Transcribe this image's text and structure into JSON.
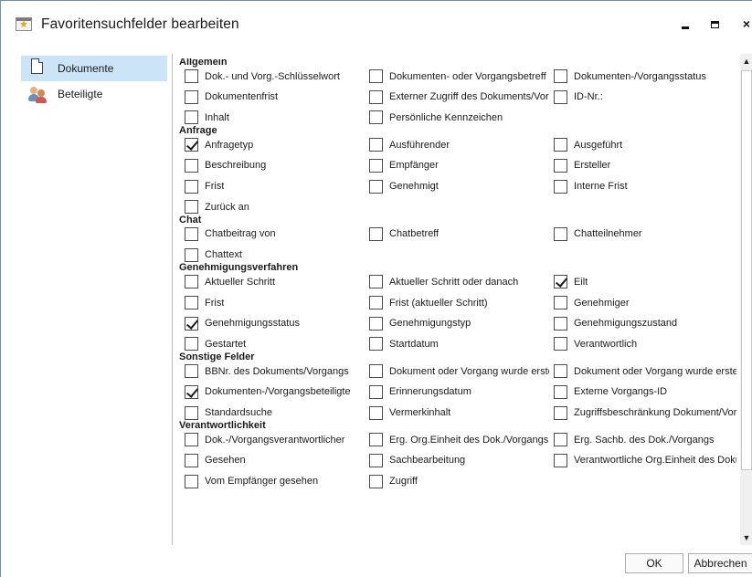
{
  "window": {
    "title": "Favoritensuchfelder bearbeiten",
    "minimize_icon": "minimize-icon",
    "maximize_icon": "maximize-icon",
    "close_label": "×"
  },
  "nav": {
    "items": [
      {
        "label": "Dokumente",
        "icon": "document-icon",
        "active": true
      },
      {
        "label": "Beteiligte",
        "icon": "people-icon",
        "active": false
      }
    ]
  },
  "sections": [
    {
      "title": "Allgemein",
      "rows": [
        [
          {
            "label": "Dok.- und Vorg.-Schlüsselwort",
            "checked": false
          },
          {
            "label": "Dokumenten- oder Vorgangsbetreff",
            "checked": false
          },
          {
            "label": "Dokumenten-/Vorgangsstatus",
            "checked": false
          }
        ],
        [
          {
            "label": "Dokumentenfrist",
            "checked": false
          },
          {
            "label": "Externer Zugriff des Dokuments/Vorgangs",
            "checked": false
          },
          {
            "label": "ID-Nr.:",
            "checked": false
          }
        ],
        [
          {
            "label": "Inhalt",
            "checked": false
          },
          {
            "label": "Persönliche Kennzeichen",
            "checked": false
          }
        ]
      ]
    },
    {
      "title": "Anfrage",
      "rows": [
        [
          {
            "label": "Anfragetyp",
            "checked": true
          },
          {
            "label": "Ausführender",
            "checked": false
          },
          {
            "label": "Ausgeführt",
            "checked": false
          }
        ],
        [
          {
            "label": "Beschreibung",
            "checked": false
          },
          {
            "label": "Empfänger",
            "checked": false
          },
          {
            "label": "Ersteller",
            "checked": false
          }
        ],
        [
          {
            "label": "Frist",
            "checked": false
          },
          {
            "label": "Genehmigt",
            "checked": false
          },
          {
            "label": "Interne Frist",
            "checked": false
          }
        ],
        [
          {
            "label": "Zurück an",
            "checked": false
          }
        ]
      ]
    },
    {
      "title": "Chat",
      "rows": [
        [
          {
            "label": "Chatbeitrag von",
            "checked": false
          },
          {
            "label": "Chatbetreff",
            "checked": false
          },
          {
            "label": "Chatteilnehmer",
            "checked": false
          }
        ],
        [
          {
            "label": "Chattext",
            "checked": false
          }
        ]
      ]
    },
    {
      "title": "Genehmigungsverfahren",
      "rows": [
        [
          {
            "label": "Aktueller Schritt",
            "checked": false
          },
          {
            "label": "Aktueller Schritt oder danach",
            "checked": false
          },
          {
            "label": "Eilt",
            "checked": true
          }
        ],
        [
          {
            "label": "Frist",
            "checked": false
          },
          {
            "label": "Frist (aktueller Schritt)",
            "checked": false
          },
          {
            "label": "Genehmiger",
            "checked": false
          }
        ],
        [
          {
            "label": "Genehmigungsstatus",
            "checked": true
          },
          {
            "label": "Genehmigungstyp",
            "checked": false
          },
          {
            "label": "Genehmigungszustand",
            "checked": false
          }
        ],
        [
          {
            "label": "Gestartet",
            "checked": false
          },
          {
            "label": "Startdatum",
            "checked": false
          },
          {
            "label": "Verantwortlich",
            "checked": false
          }
        ]
      ]
    },
    {
      "title": "Sonstige Felder",
      "rows": [
        [
          {
            "label": "BBNr. des Dokuments/Vorgangs",
            "checked": false
          },
          {
            "label": "Dokument oder Vorgang wurde erstellt",
            "checked": false
          },
          {
            "label": "Dokument oder Vorgang wurde erstellt",
            "checked": false
          }
        ],
        [
          {
            "label": "Dokumenten-/Vorgangsbeteiligte",
            "checked": true
          },
          {
            "label": "Erinnerungsdatum",
            "checked": false
          },
          {
            "label": "Externe Vorgangs-ID",
            "checked": false
          }
        ],
        [
          {
            "label": "Standardsuche",
            "checked": false
          },
          {
            "label": "Vermerkinhalt",
            "checked": false
          },
          {
            "label": "Zugriffsbeschränkung Dokument/Vorgang",
            "checked": false
          }
        ]
      ]
    },
    {
      "title": "Verantwortlichkeit",
      "rows": [
        [
          {
            "label": "Dok.-/Vorgangsverantwortlicher",
            "checked": false
          },
          {
            "label": "Erg. Org.Einheit des Dok./Vorgangs",
            "checked": false
          },
          {
            "label": "Erg. Sachb. des Dok./Vorgangs",
            "checked": false
          }
        ],
        [
          {
            "label": "Gesehen",
            "checked": false
          },
          {
            "label": "Sachbearbeitung",
            "checked": false
          },
          {
            "label": "Verantwortliche Org.Einheit des Dokuments",
            "checked": false
          }
        ],
        [
          {
            "label": "Vom Empfänger gesehen",
            "checked": false
          },
          {
            "label": "Zugriff",
            "checked": false
          }
        ]
      ]
    }
  ],
  "footer": {
    "ok_label": "OK",
    "cancel_label": "Abbrechen"
  }
}
